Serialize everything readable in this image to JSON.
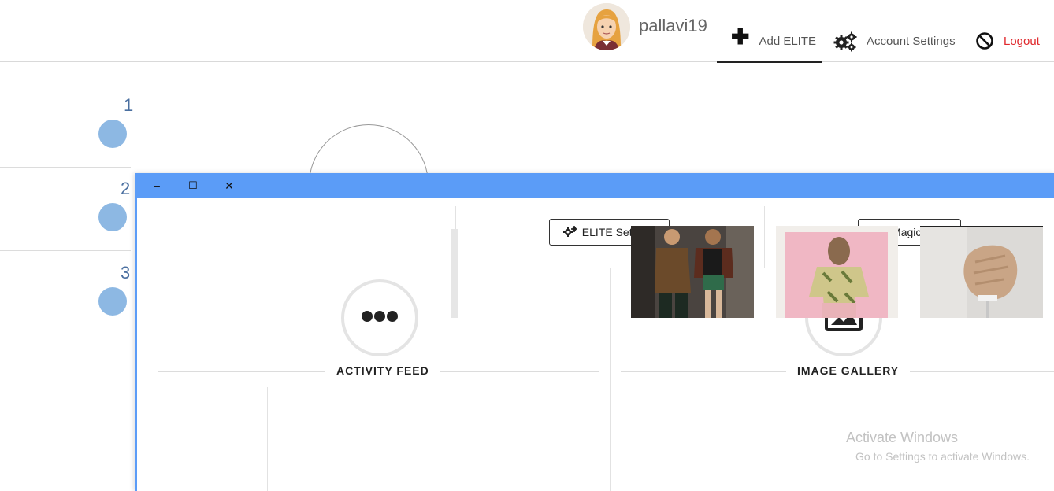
{
  "header": {
    "username": "pallavi19",
    "nav": {
      "add_elite": "Add ELITE",
      "account_settings": "Account Settings",
      "logout": "Logout"
    }
  },
  "list": {
    "items": [
      {
        "number": "1"
      },
      {
        "number": "2"
      },
      {
        "number": "3"
      }
    ]
  },
  "window": {
    "controls": {
      "minimize": "–",
      "maximize": "☐",
      "close": "✕"
    },
    "buttons": {
      "elite_settings": "ELITE Settings",
      "magic_link": "Magic Link"
    },
    "panels": {
      "activity_feed": "ACTIVITY FEED",
      "image_gallery": "IMAGE GALLERY"
    }
  },
  "watermark": {
    "line1": "Activate Windows",
    "line2": "Go to Settings to activate Windows."
  },
  "colors": {
    "titlebar": "#5b9cf7",
    "dot": "#8db8e3",
    "logout": "#e0282c",
    "list_number": "#4a6fa0"
  }
}
